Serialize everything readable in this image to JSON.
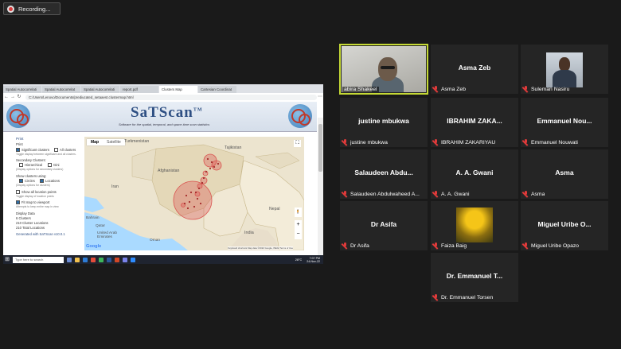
{
  "recording": {
    "label": "Recording..."
  },
  "browser": {
    "tabs": [
      "Spatial Autocorrelati",
      "Spatial Autocorrelat",
      "Spatial Autocorrelati",
      "report.pdf",
      "Clusters Map",
      "Cartesian Coordinat"
    ],
    "url": "C:/Users/Lenovo/Documents/prediucated_setaaest.clustermap.html"
  },
  "satscan": {
    "brand": "SaTScan",
    "tm": "TM",
    "tagline": "Software for the spatial, temporal, and space-time scan statistics",
    "sidebar": {
      "print": "Print",
      "print_sub": "Print",
      "significant": "Significant clusters",
      "all": "All clusters",
      "toggle_note": "Toggle display between significant and all clusters.",
      "secondary": "Secondary Clusters:",
      "hierarchical": "Hierarchical",
      "gini": "Gini",
      "secondary_note": "(Display options for secondary clusters)",
      "show_using": "Show clusters using:",
      "circles": "Circles",
      "locations": "Locations",
      "show_note": "(Display options for clusters)",
      "show_all_loc": "Show all location points",
      "show_all_note": "Toggle display of location points",
      "fit_map": "Fit map to viewport",
      "fit_note": "Attempts to keep entire map in view",
      "display_data": "Display Data",
      "clusters": "6 Clusters",
      "cluster_locs": "210 Cluster Locations",
      "total_locs": "210 Total Locations",
      "generated": "Generated with SaTScan v10.0.1"
    },
    "map": {
      "tab_map": "Map",
      "tab_sat": "Satellite",
      "labels": {
        "turkmenistan": "Turkmenistan",
        "tajikistan": "Tajikistan",
        "afghanistan": "Afghanistan",
        "iran": "Iran",
        "nepal": "Nepal",
        "bahrain": "Bahrain",
        "qatar": "Qatar",
        "uae": "United Arab Emirates",
        "oman": "Oman",
        "india": "India",
        "google": "Google"
      },
      "footer": "Keyboard shortcuts   Map data ©2022 Google, INEGI   Terms of Use"
    }
  },
  "taskbar": {
    "search": "Type here to search",
    "temp": "28°C",
    "time": "7:07 PM",
    "date": "24-Nov-22"
  },
  "participants": [
    {
      "id": "abira",
      "label": "abira Shakeel",
      "title": "",
      "video": true,
      "active": true
    },
    {
      "id": "asma-zeb",
      "label": "Asma Zeb",
      "title": "Asma Zeb"
    },
    {
      "id": "suleman",
      "label": "Suleman Nasiru",
      "title": "",
      "avatar": "man"
    },
    {
      "id": "justine",
      "label": "justine mbukwa",
      "title": "justine mbukwa"
    },
    {
      "id": "ibrahim",
      "label": "IBRAHIM ZAKARIYAU",
      "title": "IBRAHIM ZAKA..."
    },
    {
      "id": "emmanuel-n",
      "label": "Emmanuel Nouwati",
      "title": "Emmanuel Nou..."
    },
    {
      "id": "salaudeen",
      "label": "Salaudeen Abdulwaheed A...",
      "title": "Salaudeen Abdu..."
    },
    {
      "id": "gwani",
      "label": "A. A. Gwani",
      "title": "A. A. Gwani"
    },
    {
      "id": "asma",
      "label": "Asma",
      "title": "Asma"
    },
    {
      "id": "asifa",
      "label": "Dr Asifa",
      "title": "Dr Asifa"
    },
    {
      "id": "faiza",
      "label": "Faiza Baig",
      "title": "",
      "avatar": "flower"
    },
    {
      "id": "miguel",
      "label": "Miguel Uribe Opazo",
      "title": "Miguel Uribe O..."
    },
    {
      "id": "torsen",
      "label": "Dr. Emmanuel Torsen",
      "title": "Dr. Emmanuel T..."
    }
  ],
  "colors": {
    "active_border": "#c5d935",
    "muted_mic": "#e03a3a",
    "tile_bg": "#252525",
    "cluster": "#d9534f"
  }
}
